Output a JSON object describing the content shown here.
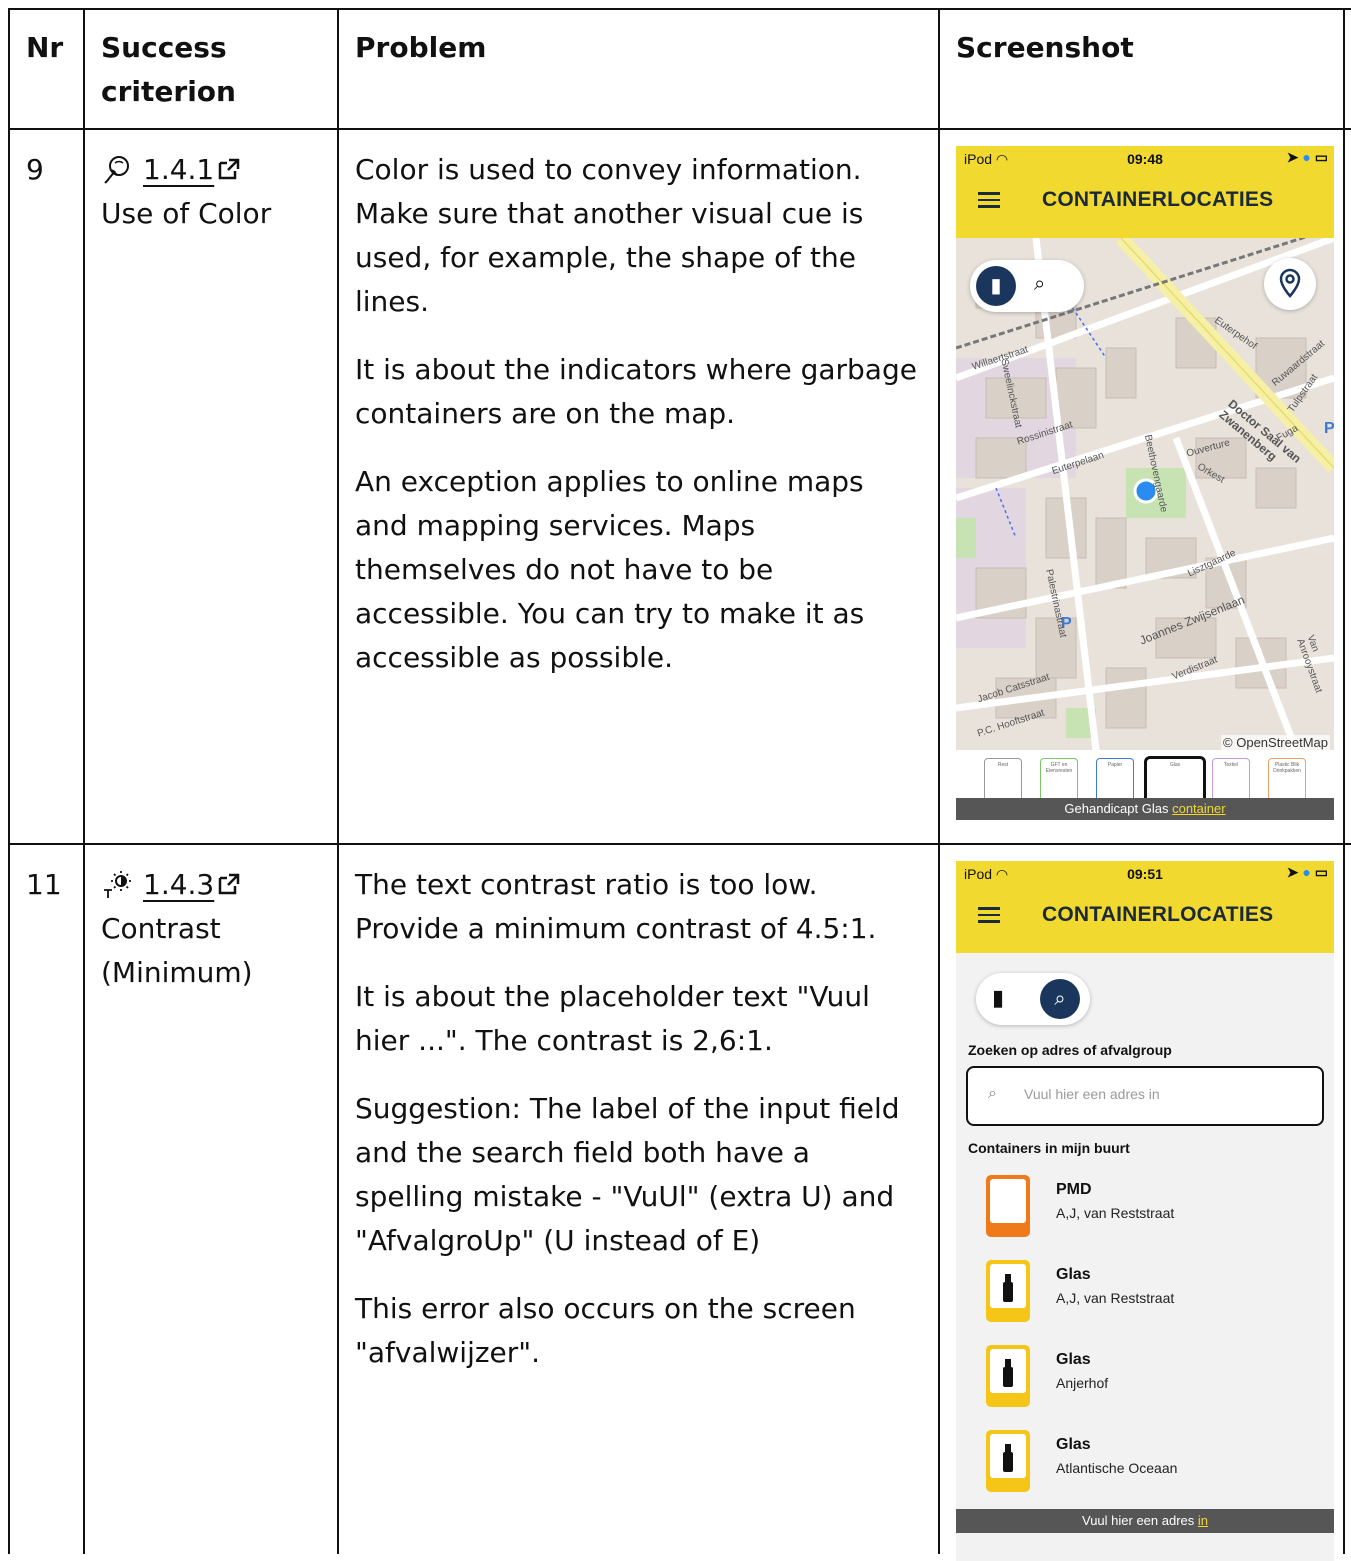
{
  "table": {
    "headers": {
      "nr": "Nr",
      "criterion": "Success criterion",
      "problem": "Problem",
      "screenshot": "Screenshot"
    },
    "rows": [
      {
        "nr": "9",
        "sc_number": "1.4.1",
        "sc_name": "Use of Color",
        "sc_icon": "eye-dropper-icon",
        "problem": [
          "Color is used to convey information. Make sure that another visual cue is used, for example, the shape of the lines.",
          "It is about the indicators where garbage containers are on the map.",
          "An exception applies to online maps and mapping services. Maps themselves do not have to be accessible. You can try to make it as accessible as possible."
        ]
      },
      {
        "nr": "11",
        "sc_number": "1.4.3",
        "sc_name": "Contrast (Minimum)",
        "sc_icon": "contrast-brightness-icon",
        "problem": [
          "The text contrast ratio is too low. Provide a minimum contrast of 4.5:1.",
          "It is about the placeholder text \"Vuul hier ...\". The contrast is 2,6:1.",
          "Suggestion: The label of the input field and the search field both have a spelling mistake - \"VuUl\" (extra U) and \"AfvalgroUp\" (U instead of E)",
          "This error also occurs on the screen \"afvalwijzer\"."
        ]
      }
    ]
  },
  "screenshot1": {
    "status_left": "iPod",
    "time": "09:48",
    "title": "CONTAINERLOCATIES",
    "map_attribution": "© OpenStreetMap",
    "street_labels": [
      "Euterpelaan",
      "Doctor Saal van Zwanenberg",
      "Rossinistraat",
      "Beethovengaarde",
      "Lisztgaarde",
      "Joannes Zwijsenlaan",
      "Verdistraat",
      "Jacob Catsstraat",
      "P.C. Hooftstraat",
      "Ouverture",
      "Orkest",
      "Fuga",
      "Willaertstraat",
      "Sweelinckstraat",
      "Ruwaardstraat",
      "Euterpehof",
      "Palestrinastraat",
      "Tulpstraat",
      "Van Anrooystraat"
    ],
    "bins": [
      "Rest",
      "GFT en Etensresten",
      "Papier",
      "Glas",
      "Textiel",
      "Plastic Blik Drinkpakken"
    ],
    "toast_text": "Gehandicapt Glas ",
    "toast_highlight": "container"
  },
  "screenshot2": {
    "status_left": "iPod",
    "time": "09:51",
    "title": "CONTAINERLOCATIES",
    "search_label": "Zoeken op adres of afvalgroup",
    "search_placeholder": "Vuul hier een adres in",
    "list_heading": "Containers in mijn buurt",
    "containers": [
      {
        "name": "PMD",
        "address": "A,J, van Reststraat",
        "color": "#f07a1a",
        "icon_label": "Plastic Blik Drinkpakken"
      },
      {
        "name": "Glas",
        "address": "A,J, van Reststraat",
        "color": "#f5c518",
        "icon_label": "Glas"
      },
      {
        "name": "Glas",
        "address": "Anjerhof",
        "color": "#f5c518",
        "icon_label": "Glas"
      },
      {
        "name": "Glas",
        "address": "Atlantische Oceaan",
        "color": "#f5c518",
        "icon_label": "Glas"
      }
    ],
    "toast_text": "Vuul hier een adres ",
    "toast_highlight": "in"
  },
  "colors": {
    "app_yellow": "#f2d930",
    "navy": "#1b365d",
    "location_blue": "#2a8cf0"
  }
}
